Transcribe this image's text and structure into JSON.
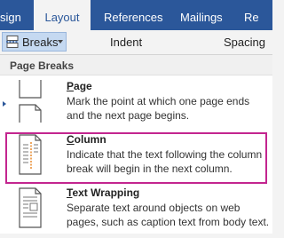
{
  "ribbon": {
    "tabs": [
      {
        "label": "sign"
      },
      {
        "label": "Layout"
      },
      {
        "label": "References"
      },
      {
        "label": "Mailings"
      },
      {
        "label": "Re"
      }
    ],
    "breaks_label": "Breaks",
    "indent_label": "Indent",
    "spacing_label": "Spacing"
  },
  "menu": {
    "section_title": "Page Breaks",
    "items": [
      {
        "key": "P",
        "rest": "age",
        "desc1": "Mark the point at which one page ends",
        "desc2": "and the next page begins.",
        "icon": "page-break-icon"
      },
      {
        "key": "C",
        "rest": "olumn",
        "desc1": "Indicate that the text following the column",
        "desc2": "break will begin in the next column.",
        "icon": "column-break-icon"
      },
      {
        "key": "T",
        "rest": "ext Wrapping",
        "desc1": "Separate text around objects on web",
        "desc2": "pages, such as caption text from body text.",
        "icon": "text-wrapping-icon"
      }
    ]
  },
  "colors": {
    "ribbon": "#2b579a",
    "highlight": "#c3258f",
    "icon_accent": "#e6821e"
  }
}
